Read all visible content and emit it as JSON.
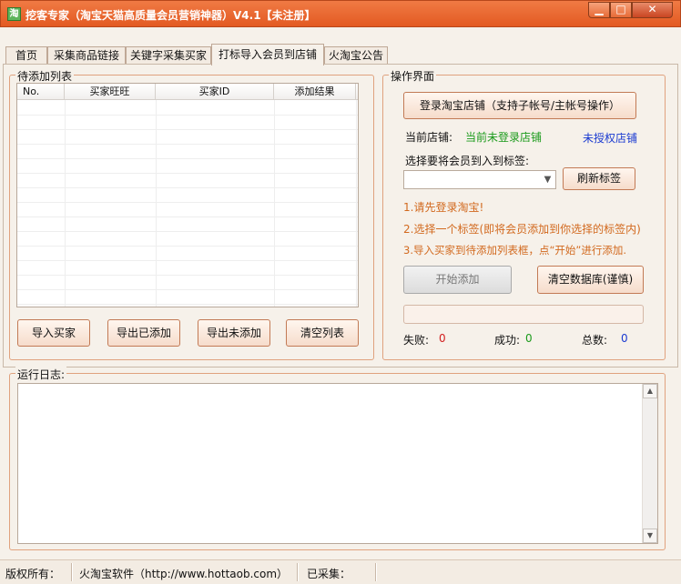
{
  "window": {
    "icon_text": "淘",
    "title": "挖客专家（淘宝天猫高质量会员营销神器）V4.1【未注册】",
    "minimize": "▁",
    "maximize": "□",
    "close": "✕"
  },
  "tabs": [
    "首页",
    "采集商品链接",
    "关键字采集买家",
    "打标导入会员到店铺",
    "火淘宝公告"
  ],
  "active_tab": 3,
  "pending_list": {
    "title": "待添加列表",
    "columns": [
      "No.",
      "买家旺旺",
      "买家ID",
      "添加结果"
    ],
    "rows": [],
    "buttons": {
      "import": "导入买家",
      "export_added": "导出已添加",
      "export_unadded": "导出未添加",
      "clear": "清空列表"
    }
  },
  "operation": {
    "title": "操作界面",
    "login_button": "登录淘宝店铺（支持子帐号/主帐号操作）",
    "current_shop_label": "当前店铺:",
    "current_shop_value": "当前未登录店铺",
    "auth_status": "未授权店铺",
    "select_tag_label": "选择要将会员到入到标签:",
    "tag_selected": "",
    "refresh_tag_button": "刷新标签",
    "steps": [
      "1.请先登录淘宝!",
      "2.选择一个标签(即将会员添加到你选择的标签内)",
      "3.导入买家到待添加列表框，点“开始”进行添加."
    ],
    "start_button": "开始添加",
    "clear_db_button": "清空数据库(谨慎)",
    "progress": 0,
    "fail_label": "失败:",
    "fail_value": "0",
    "success_label": "成功:",
    "success_value": "0",
    "total_label": "总数:",
    "total_value": "0"
  },
  "log": {
    "title": "运行日志:",
    "content": ""
  },
  "statusbar": {
    "copyright": "版权所有：",
    "company": "火淘宝软件（http://www.hottaob.com）",
    "collected": "已采集："
  },
  "colors": {
    "titlebar": "#e8622b",
    "group_border": "#e0a27e",
    "shop_value": "#1a9a1a",
    "auth_status": "#1a3ad1",
    "steps": "#d2691e",
    "fail_value": "#d21e1e",
    "success_value": "#1a9a1a",
    "total_value": "#1a3ad1"
  }
}
